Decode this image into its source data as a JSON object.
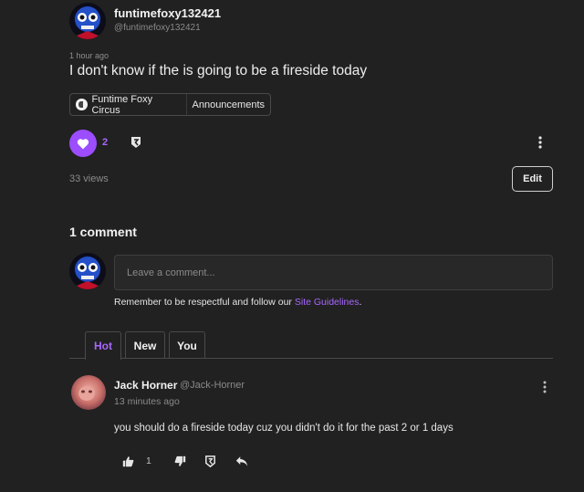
{
  "post": {
    "author": "funtimefoxy132421",
    "handle": "@funtimefoxy132421",
    "time": "1 hour ago",
    "title": "I don't know if the is going to be a fireside today",
    "tags": [
      "Funtime Foxy Circus",
      "Announcements"
    ],
    "like_count": "2",
    "views": "33 views",
    "edit_label": "Edit"
  },
  "comments_section": {
    "title": "1 comment",
    "input_placeholder": "Leave a comment...",
    "guidelines_prefix": "Remember to be respectful and follow our ",
    "guidelines_link": "Site Guidelines",
    "guidelines_suffix": ".",
    "tabs": [
      "Hot",
      "New",
      "You"
    ],
    "active_tab": "Hot"
  },
  "comment": {
    "author": "Jack Horner",
    "handle": "@Jack-Horner",
    "time": "13 minutes ago",
    "text": "you should do a fireside today cuz you didn't do it for the past 2 or 1 days",
    "score": "1"
  },
  "colors": {
    "accent": "#a866ff",
    "like_bg": "#9b4dff",
    "background": "#212121"
  },
  "icons": [
    "heart-icon",
    "award-icon",
    "more-vertical-icon",
    "thumbs-up-icon",
    "thumbs-down-icon",
    "reply-icon"
  ]
}
